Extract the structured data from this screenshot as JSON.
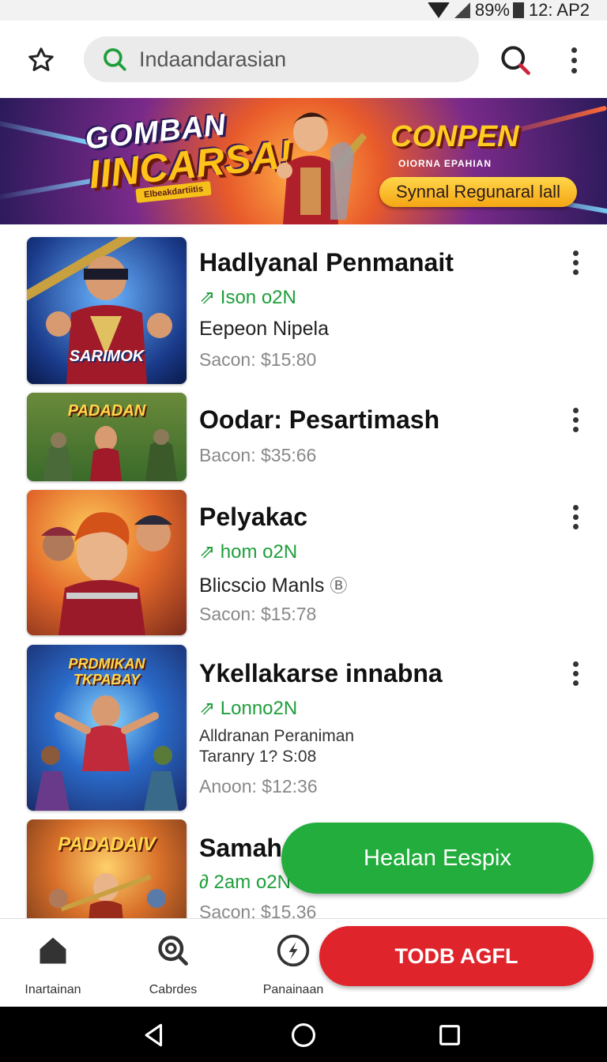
{
  "status_bar": {
    "battery": "89%",
    "time": "12: AP2"
  },
  "top_bar": {
    "search_text": "Indaandarasian",
    "icons": [
      "star-icon",
      "search-icon",
      "more-vert-icon"
    ]
  },
  "banner": {
    "title_line1": "GOMBAN",
    "title_line2": "IINCARSA!",
    "small_tag": "Elbeakdartiitis",
    "right_title": "CONPEN",
    "right_sub": "OIORNA EPAHIAN",
    "pill": "Synnal Regunaral lall"
  },
  "items": [
    {
      "thumb_label": "SARIMOK",
      "title": "Hadlyanal Penmanait",
      "tag": "Ison o2N",
      "subtitle": "Eepeon Nipela",
      "price": "Sacon: $15:80"
    },
    {
      "thumb_label": "PADADAN",
      "title": "Oodar: Pesartimash",
      "price": "Bacon: $35:66"
    },
    {
      "thumb_label": "",
      "title": "Pelyakac",
      "tag": "hom o2N",
      "subtitle": "Blicscio Manls",
      "price": "Sacon: $15:78"
    },
    {
      "thumb_label": "PRDMIKAN TKPABAY",
      "title": "Ykellakarse innabna",
      "tag": "Lonno2N",
      "subtitle_line1": "Alldranan Peraniman",
      "subtitle_line2": "Taranry 1? S:08",
      "price": "Anoon: $12:36"
    },
    {
      "thumb_label": "PADADAIV",
      "title": "Samah",
      "tag": "2am o2N",
      "price": "Sacon: $15.36"
    }
  ],
  "fab_green": "Healan Eespix",
  "fab_red": "TODB AGFL",
  "bottom_nav": [
    {
      "label": "Inartainan",
      "icon": "home-icon"
    },
    {
      "label": "Cabrdes",
      "icon": "search-icon"
    },
    {
      "label": "Panainaan",
      "icon": "compass-icon"
    }
  ],
  "colors": {
    "accent_green": "#22ad3c",
    "accent_red": "#e0242c",
    "tag_green": "#1e9e3a"
  }
}
